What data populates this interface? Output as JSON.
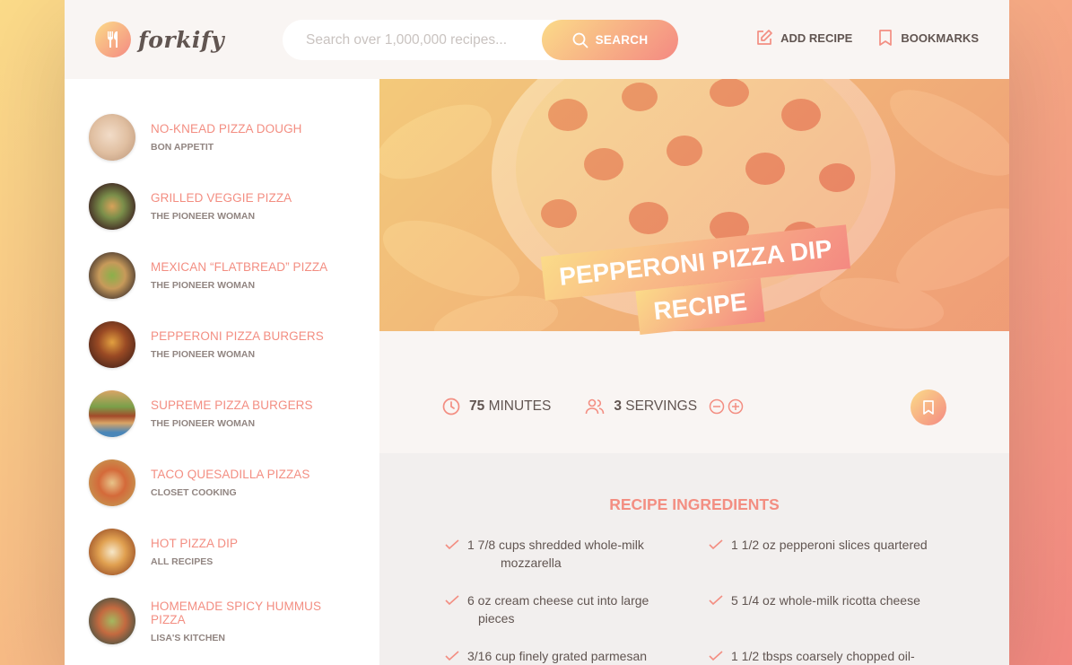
{
  "app": {
    "name": "forkify"
  },
  "search": {
    "placeholder": "Search over 1,000,000 recipes...",
    "button_label": "SEARCH"
  },
  "nav": {
    "add_recipe": "ADD RECIPE",
    "bookmarks": "BOOKMARKS"
  },
  "results": [
    {
      "title": "NO-KNEAD PIZZA DOUGH",
      "publisher": "BON APPETIT",
      "thumb": "dough"
    },
    {
      "title": "GRILLED VEGGIE PIZZA",
      "publisher": "THE PIONEER WOMAN",
      "thumb": "veggie"
    },
    {
      "title": "MEXICAN “FLATBREAD” PIZZA",
      "publisher": "THE PIONEER WOMAN",
      "thumb": "flatbread"
    },
    {
      "title": "PEPPERONI PIZZA BURGERS",
      "publisher": "THE PIONEER WOMAN",
      "thumb": "burger"
    },
    {
      "title": "SUPREME PIZZA BURGERS",
      "publisher": "THE PIONEER WOMAN",
      "thumb": "supreme"
    },
    {
      "title": "TACO QUESADILLA PIZZAS",
      "publisher": "CLOSET COOKING",
      "thumb": "taco"
    },
    {
      "title": "HOT PIZZA DIP",
      "publisher": "ALL RECIPES",
      "thumb": "dip"
    },
    {
      "title": "HOMEMADE SPICY HUMMUS PIZZA",
      "publisher": "LISA'S KITCHEN",
      "thumb": "hummus"
    }
  ],
  "recipe": {
    "title_line1": "PEPPERONI PIZZA DIP",
    "title_line2": "RECIPE",
    "minutes": "75",
    "minutes_label": "MINUTES",
    "servings": "3",
    "servings_label": "SERVINGS",
    "ingredients_heading": "RECIPE INGREDIENTS",
    "ingredients": [
      {
        "line1": "1 7/8 cups shredded whole-milk",
        "line2": "mozzarella"
      },
      {
        "line1": "1 1/2 oz pepperoni slices quartered",
        "line2": ""
      },
      {
        "line1": "6 oz cream cheese cut into large",
        "line2": "pieces"
      },
      {
        "line1": "5 1/4 oz whole-milk ricotta cheese",
        "line2": ""
      },
      {
        "line1": "3/16 cup finely grated parmesan",
        "line2": ""
      },
      {
        "line1": "1 1/2 tbsps coarsely chopped oil-",
        "line2": ""
      }
    ]
  },
  "colors": {
    "accent": "#f38e82",
    "grad_start": "#fbdb89",
    "grad_end": "#f48982",
    "text": "#615551",
    "bg": "#f9f5f3"
  }
}
